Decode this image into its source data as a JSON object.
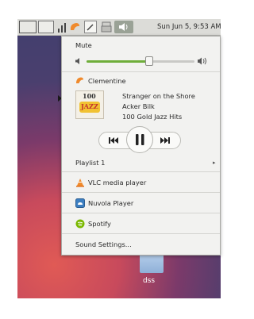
{
  "panel": {
    "clock": "Sun Jun  5,  9:53 AM"
  },
  "volume": {
    "mute_label": "Mute",
    "level": 0.58,
    "low_icon": "speaker-low-icon",
    "high_icon": "speaker-high-icon"
  },
  "player": {
    "name": "Clementine",
    "track": "Stranger on the Shore",
    "artist": "Acker Bilk",
    "album": "100 Gold Jazz Hits",
    "album_art_text": "100",
    "album_art_subtext": "JAZZ",
    "playlist_label": "Playlist 1"
  },
  "apps": [
    {
      "name": "VLC media player",
      "icon": "vlc-icon"
    },
    {
      "name": "Nuvola Player",
      "icon": "nuvola-icon"
    },
    {
      "name": "Spotify",
      "icon": "spotify-icon"
    }
  ],
  "sound_settings": "Sound Settings...",
  "desktop": {
    "folder_label": "dss"
  },
  "colors": {
    "accent_green": "#6fae3a",
    "clementine_orange": "#f08a2c",
    "spotify_green": "#7ab800"
  }
}
